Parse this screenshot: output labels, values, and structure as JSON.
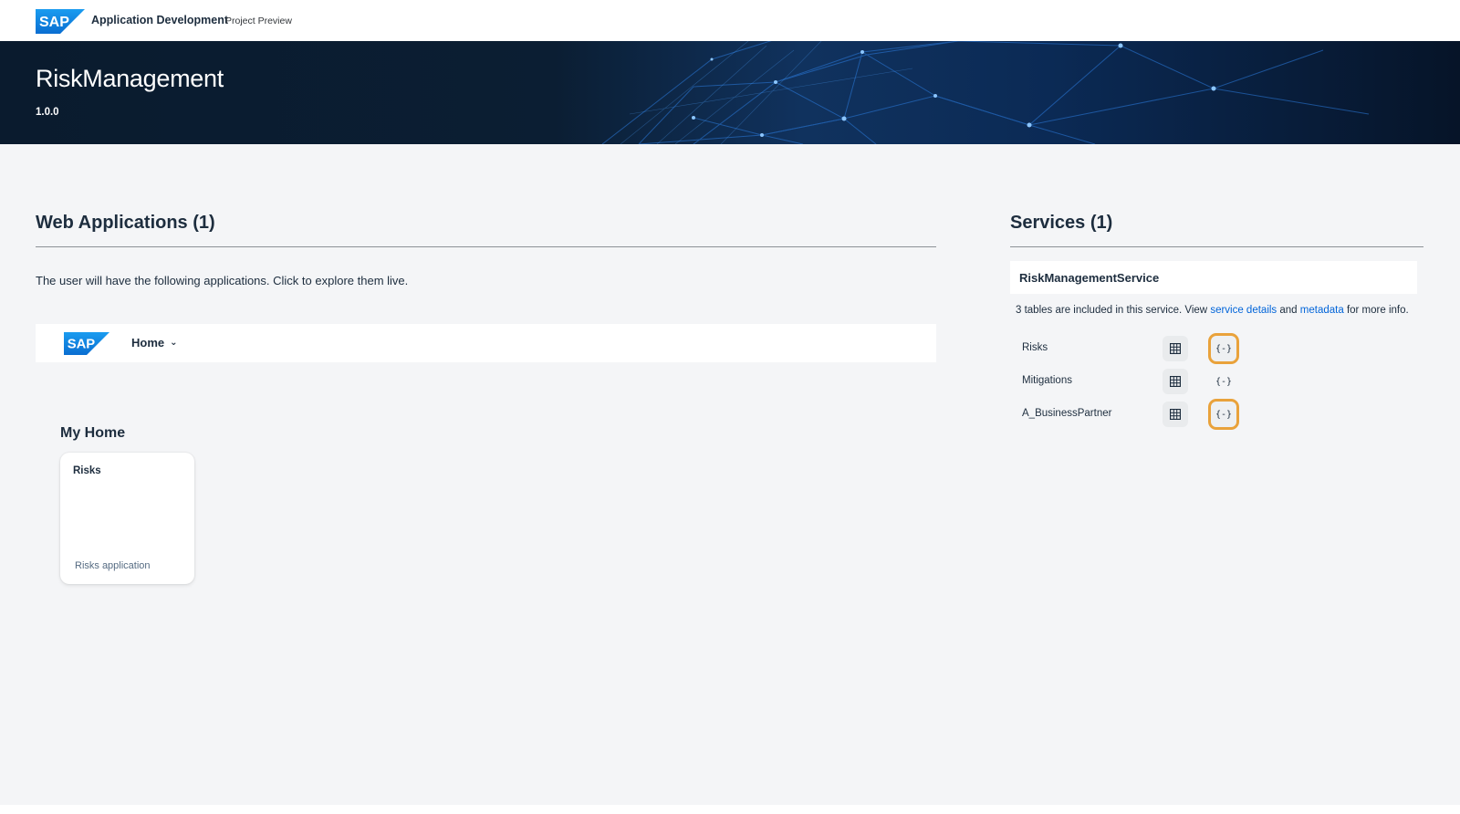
{
  "shell": {
    "logo_text": "SAP",
    "title": "Application Development",
    "subtitle": "Project Preview"
  },
  "hero": {
    "title": "RiskManagement",
    "version": "1.0.0"
  },
  "web_apps": {
    "heading": "Web Applications (1)",
    "intro": "The user will have the following applications. Click to explore them live.",
    "app_shell": {
      "logo_text": "SAP",
      "menu_label": "Home"
    },
    "section_title": "My Home",
    "tiles": [
      {
        "title": "Risks",
        "subtitle": "Risks application"
      }
    ]
  },
  "services": {
    "heading": "Services (1)",
    "service_name": "RiskManagementService",
    "desc_prefix": "3 tables are included in this service. View",
    "link_details": "service details",
    "desc_and": "and",
    "link_metadata": "metadata",
    "desc_suffix": "for more info.",
    "tables": [
      {
        "name": "Risks",
        "highlighted": true
      },
      {
        "name": "Mitigations",
        "highlighted": false
      },
      {
        "name": "A_BusinessPartner",
        "highlighted": true
      }
    ],
    "icons": {
      "table": "table-grid-icon",
      "api": "api-braces-icon"
    },
    "api_glyph": "{-}"
  },
  "colors": {
    "brand_blue": "#0070f2",
    "link": "#0064d9",
    "highlight": "#e9a23b",
    "background": "#f4f5f7"
  }
}
